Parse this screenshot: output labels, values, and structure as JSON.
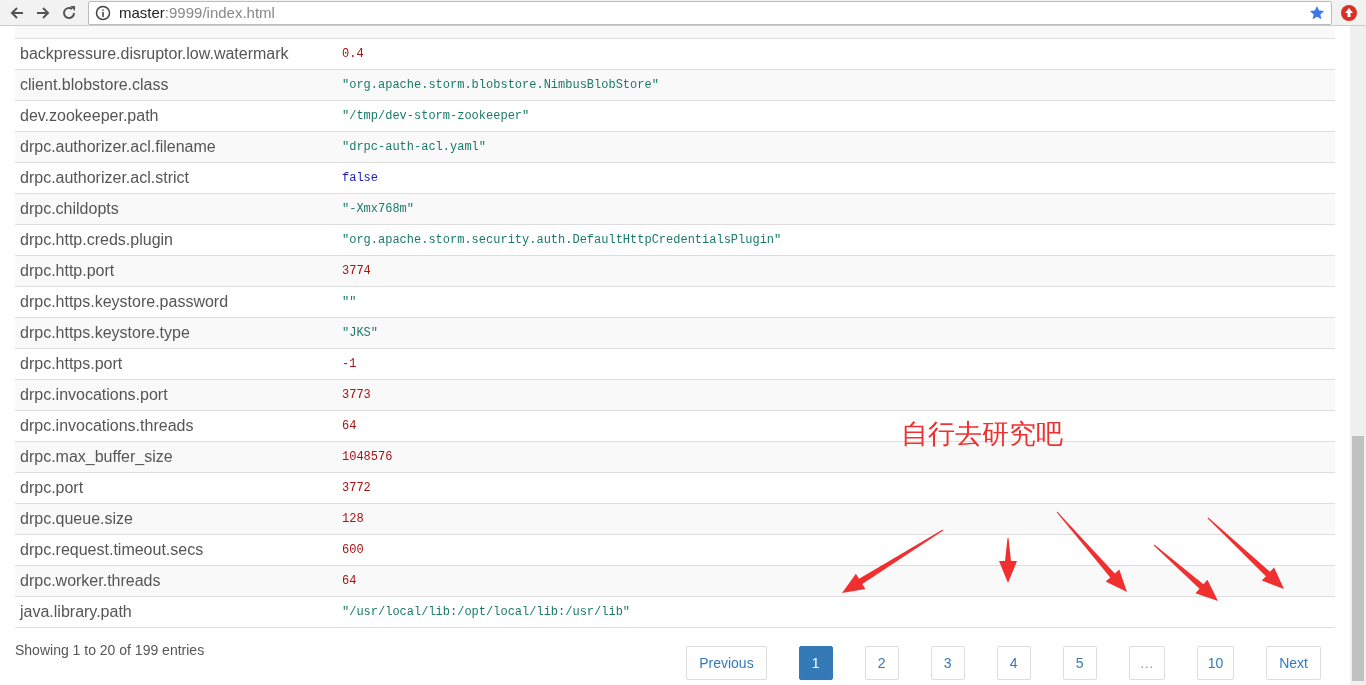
{
  "browser": {
    "url_host": "master",
    "url_path": ":9999/index.html"
  },
  "table": {
    "rows": [
      {
        "key": "backpressure.disruptor.low.watermark",
        "value": "0.4",
        "kind": "number"
      },
      {
        "key": "client.blobstore.class",
        "value": "\"org.apache.storm.blobstore.NimbusBlobStore\"",
        "kind": "string"
      },
      {
        "key": "dev.zookeeper.path",
        "value": "\"/tmp/dev-storm-zookeeper\"",
        "kind": "string"
      },
      {
        "key": "drpc.authorizer.acl.filename",
        "value": "\"drpc-auth-acl.yaml\"",
        "kind": "string"
      },
      {
        "key": "drpc.authorizer.acl.strict",
        "value": "false",
        "kind": "boolean"
      },
      {
        "key": "drpc.childopts",
        "value": "\"-Xmx768m\"",
        "kind": "string"
      },
      {
        "key": "drpc.http.creds.plugin",
        "value": "\"org.apache.storm.security.auth.DefaultHttpCredentialsPlugin\"",
        "kind": "string"
      },
      {
        "key": "drpc.http.port",
        "value": "3774",
        "kind": "number"
      },
      {
        "key": "drpc.https.keystore.password",
        "value": "\"\"",
        "kind": "string"
      },
      {
        "key": "drpc.https.keystore.type",
        "value": "\"JKS\"",
        "kind": "string"
      },
      {
        "key": "drpc.https.port",
        "value": "-1",
        "kind": "number"
      },
      {
        "key": "drpc.invocations.port",
        "value": "3773",
        "kind": "number"
      },
      {
        "key": "drpc.invocations.threads",
        "value": "64",
        "kind": "number"
      },
      {
        "key": "drpc.max_buffer_size",
        "value": "1048576",
        "kind": "number"
      },
      {
        "key": "drpc.port",
        "value": "3772",
        "kind": "number"
      },
      {
        "key": "drpc.queue.size",
        "value": "128",
        "kind": "number"
      },
      {
        "key": "drpc.request.timeout.secs",
        "value": "600",
        "kind": "number"
      },
      {
        "key": "drpc.worker.threads",
        "value": "64",
        "kind": "number"
      },
      {
        "key": "java.library.path",
        "value": "\"/usr/local/lib:/opt/local/lib:/usr/lib\"",
        "kind": "string"
      }
    ]
  },
  "info": "Showing 1 to 20 of 199 entries",
  "pagination": [
    {
      "label": "Previous",
      "kind": "nav",
      "selected": false
    },
    {
      "label": "1",
      "kind": "page",
      "selected": true
    },
    {
      "label": "2",
      "kind": "page",
      "selected": false
    },
    {
      "label": "3",
      "kind": "page",
      "selected": false
    },
    {
      "label": "4",
      "kind": "page",
      "selected": false
    },
    {
      "label": "5",
      "kind": "page",
      "selected": false
    },
    {
      "label": "…",
      "kind": "ellipsis",
      "selected": false
    },
    {
      "label": "10",
      "kind": "page",
      "selected": false
    },
    {
      "label": "Next",
      "kind": "nav",
      "selected": false
    }
  ],
  "annotation": {
    "text": "自行去研究吧"
  }
}
